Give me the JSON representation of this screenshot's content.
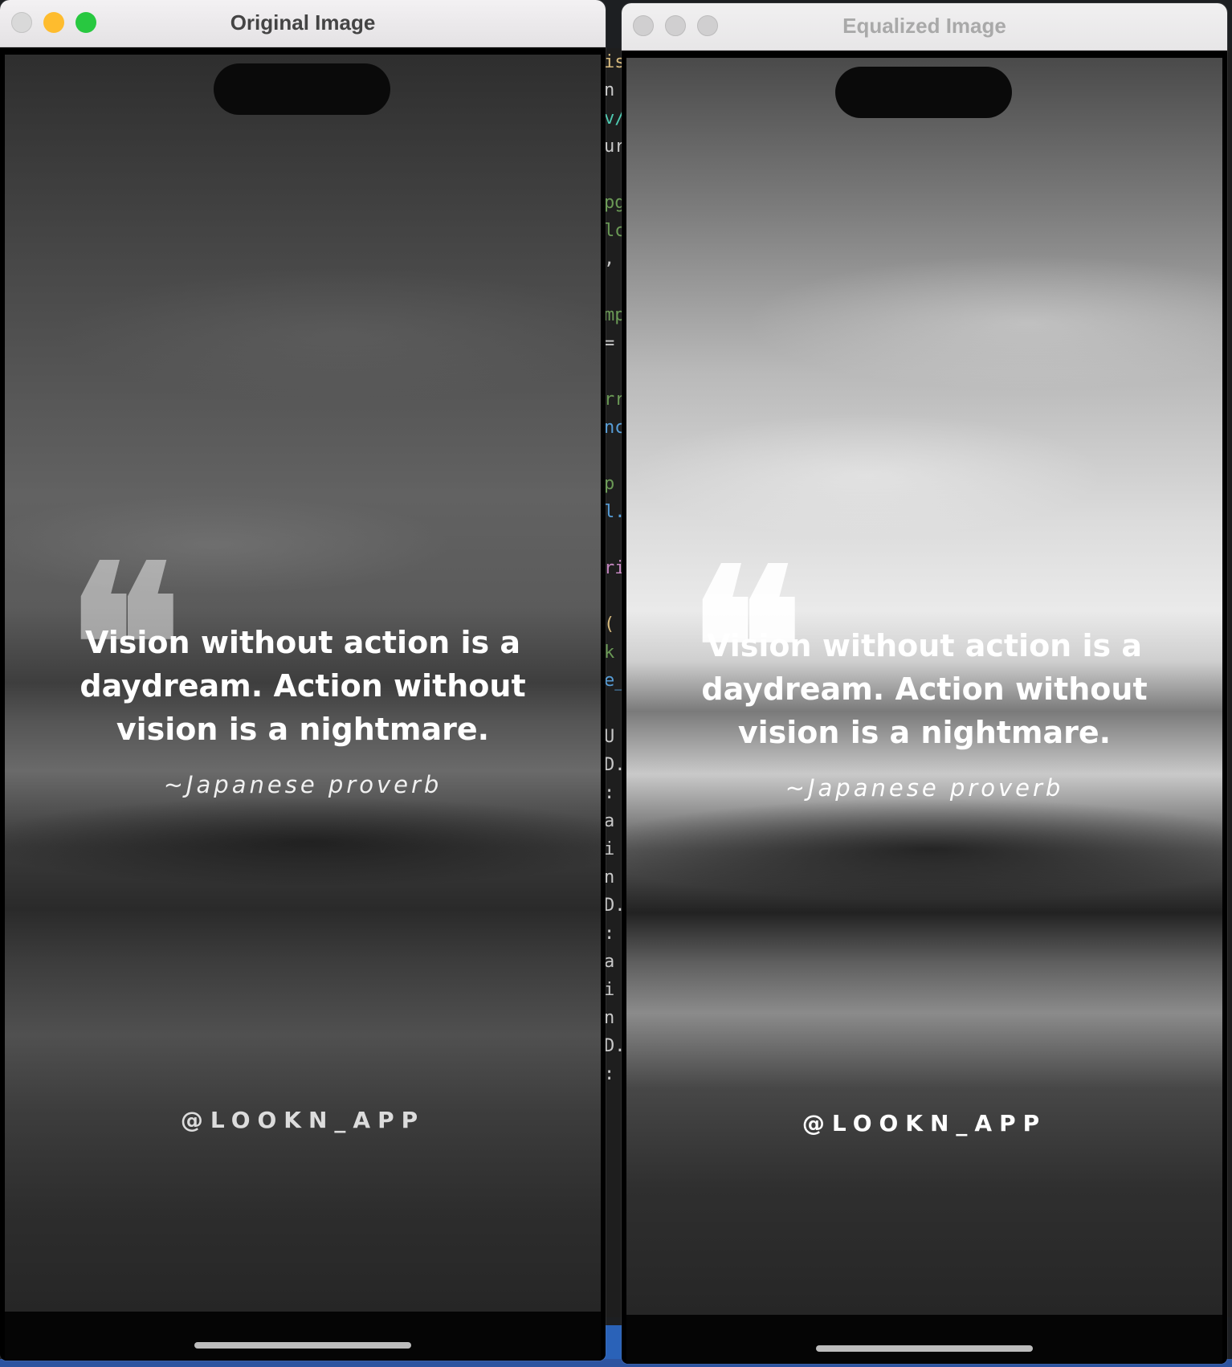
{
  "editor_fragments": [
    "is",
    "n",
    "v/",
    "ur",
    "",
    "pg",
    "lc",
    ",",
    "",
    "mp",
    "=",
    "",
    "rr",
    "nc",
    "",
    "p",
    "l.",
    "",
    "ri",
    "",
    "(",
    "k",
    "e_",
    "",
    "U",
    "D.",
    ": I",
    "a",
    "i",
    "n",
    "D.",
    ": I",
    "a",
    "i",
    "n",
    "D.",
    ": I"
  ],
  "windows": [
    {
      "title": "Original Image",
      "state": "active",
      "quote_mark": "❝",
      "quote": "Vision without action is a daydream. Action without vision is a nightmare.",
      "attribution": "~Japanese proverb",
      "handle": "@LOOKN_APP"
    },
    {
      "title": "Equalized Image",
      "state": "inactive",
      "quote_mark": "❝",
      "quote": "Vision without action is a daydream. Action without vision is a nightmare.",
      "attribution": "~Japanese proverb",
      "handle": "@LOOKN_APP"
    }
  ],
  "colors": {
    "close": "#d9d9d9",
    "minimize": "#febc2e",
    "maximize": "#28c840",
    "taskbar": "#2d54a0"
  }
}
